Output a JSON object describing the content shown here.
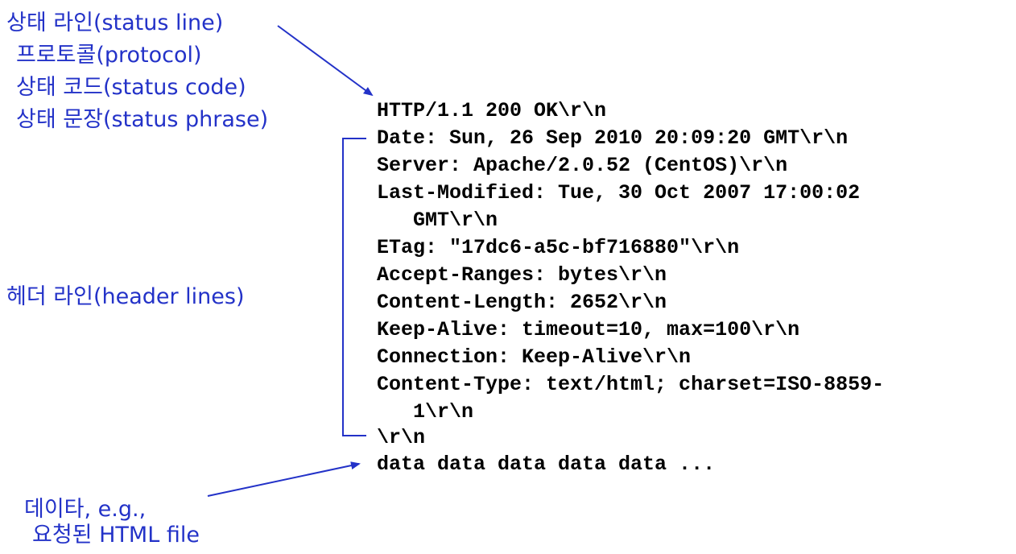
{
  "colors": {
    "annotation": "#2332c8",
    "message_text": "#000000"
  },
  "annotations": {
    "status_line": "상태 라인(status line)",
    "protocol": "프로토콜(protocol)",
    "status_code": "상태 코드(status code)",
    "status_phrase": "상태 문장(status phrase)",
    "header_lines": "헤더 라인(header lines)",
    "data_line1": "데이타, e.g.,",
    "data_line2": "요청된 HTML file"
  },
  "http_response": {
    "status_line": "HTTP/1.1 200 OK\\r\\n",
    "headers": [
      "Date: Sun, 26 Sep 2010 20:09:20 GMT\\r\\n",
      "Server: Apache/2.0.52 (CentOS)\\r\\n",
      "Last-Modified: Tue, 30 Oct 2007 17:00:02",
      "   GMT\\r\\n",
      "ETag: \"17dc6-a5c-bf716880\"\\r\\n",
      "Accept-Ranges: bytes\\r\\n",
      "Content-Length: 2652\\r\\n",
      "Keep-Alive: timeout=10, max=100\\r\\n",
      "Connection: Keep-Alive\\r\\n",
      "Content-Type: text/html; charset=ISO-8859-",
      "   1\\r\\n",
      "\\r\\n"
    ],
    "body": "data data data data data ..."
  }
}
